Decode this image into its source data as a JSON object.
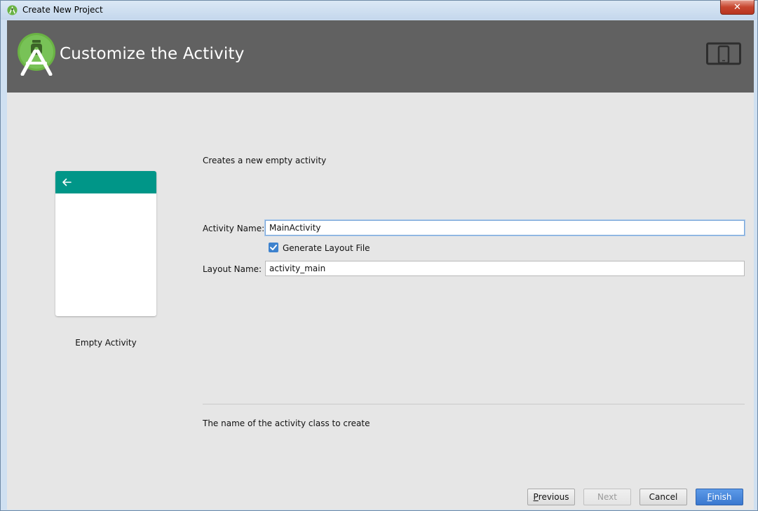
{
  "window": {
    "title": "Create New Project",
    "close_symbol": "✕"
  },
  "header": {
    "title": "Customize the Activity",
    "logo_icon": "android-studio-icon",
    "device_icon": "phone-tablet-icon"
  },
  "preview": {
    "label": "Empty Activity",
    "toolbar_color": "#009688"
  },
  "form": {
    "description": "Creates a new empty activity",
    "activity_name_label": "Activity Name:",
    "activity_name_value": "MainActivity",
    "generate_layout_label": "Generate Layout File",
    "generate_layout_checked": true,
    "layout_name_label": "Layout Name:",
    "layout_name_value": "activity_main",
    "help_text": "The name of the activity class to create"
  },
  "buttons": {
    "previous_mnemonic": "P",
    "previous_rest": "revious",
    "next": "Next",
    "cancel": "Cancel",
    "finish_mnemonic": "F",
    "finish_rest": "inish"
  }
}
